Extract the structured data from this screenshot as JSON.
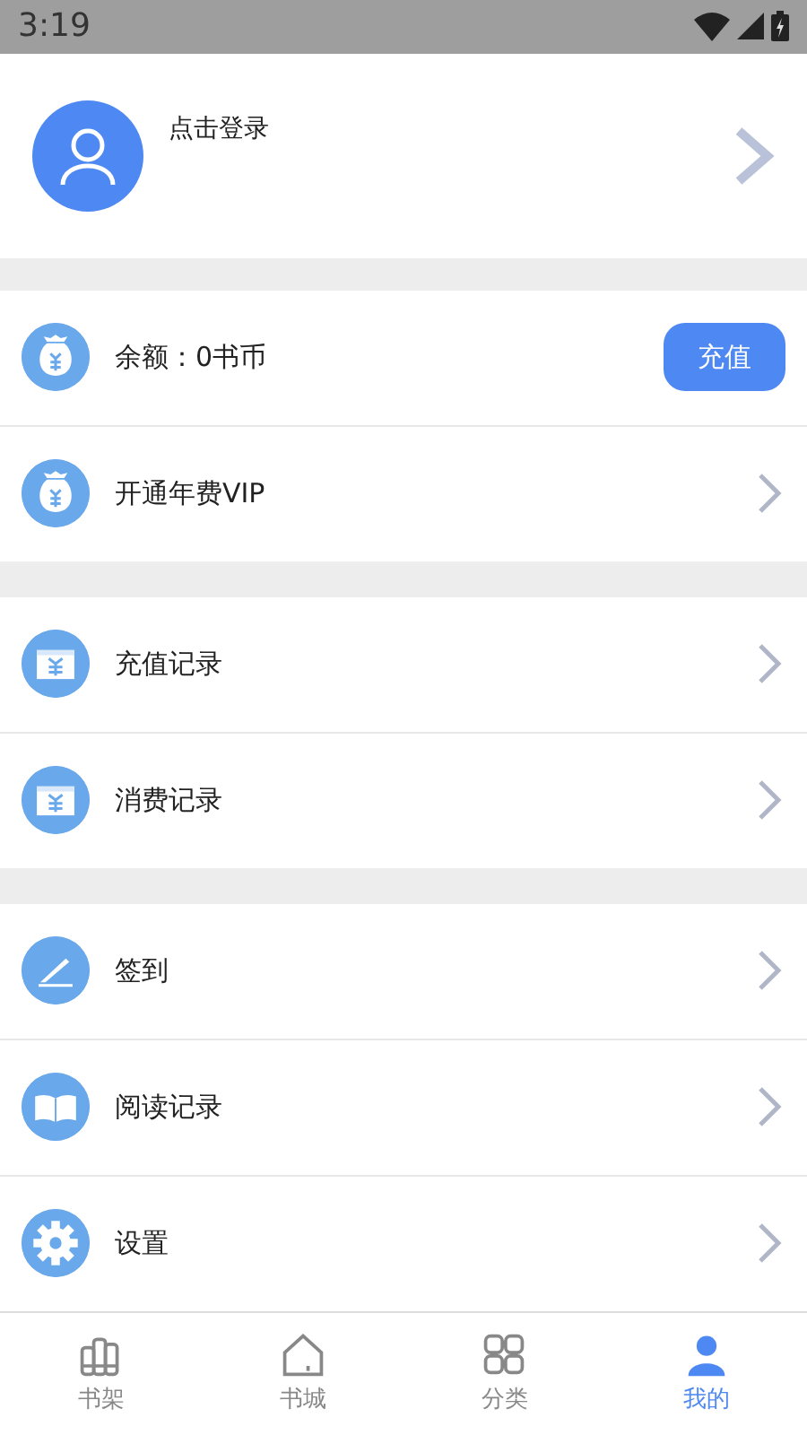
{
  "status_bar": {
    "time": "3:19"
  },
  "profile": {
    "login_label": "点击登录"
  },
  "groups": [
    [
      {
        "label": "余额：0书币",
        "kind": "button",
        "button_label": "充值"
      },
      {
        "label": "开通年费VIP",
        "kind": "chevron"
      }
    ],
    [
      {
        "label": "充值记录",
        "kind": "chevron"
      },
      {
        "label": "消费记录",
        "kind": "chevron"
      }
    ],
    [
      {
        "label": "签到",
        "kind": "chevron"
      },
      {
        "label": "阅读记录",
        "kind": "chevron"
      },
      {
        "label": "设置",
        "kind": "chevron"
      }
    ]
  ],
  "tabs": [
    {
      "label": "书架",
      "selected": false
    },
    {
      "label": "书城",
      "selected": false
    },
    {
      "label": "分类",
      "selected": false
    },
    {
      "label": "我的",
      "selected": true
    }
  ]
}
